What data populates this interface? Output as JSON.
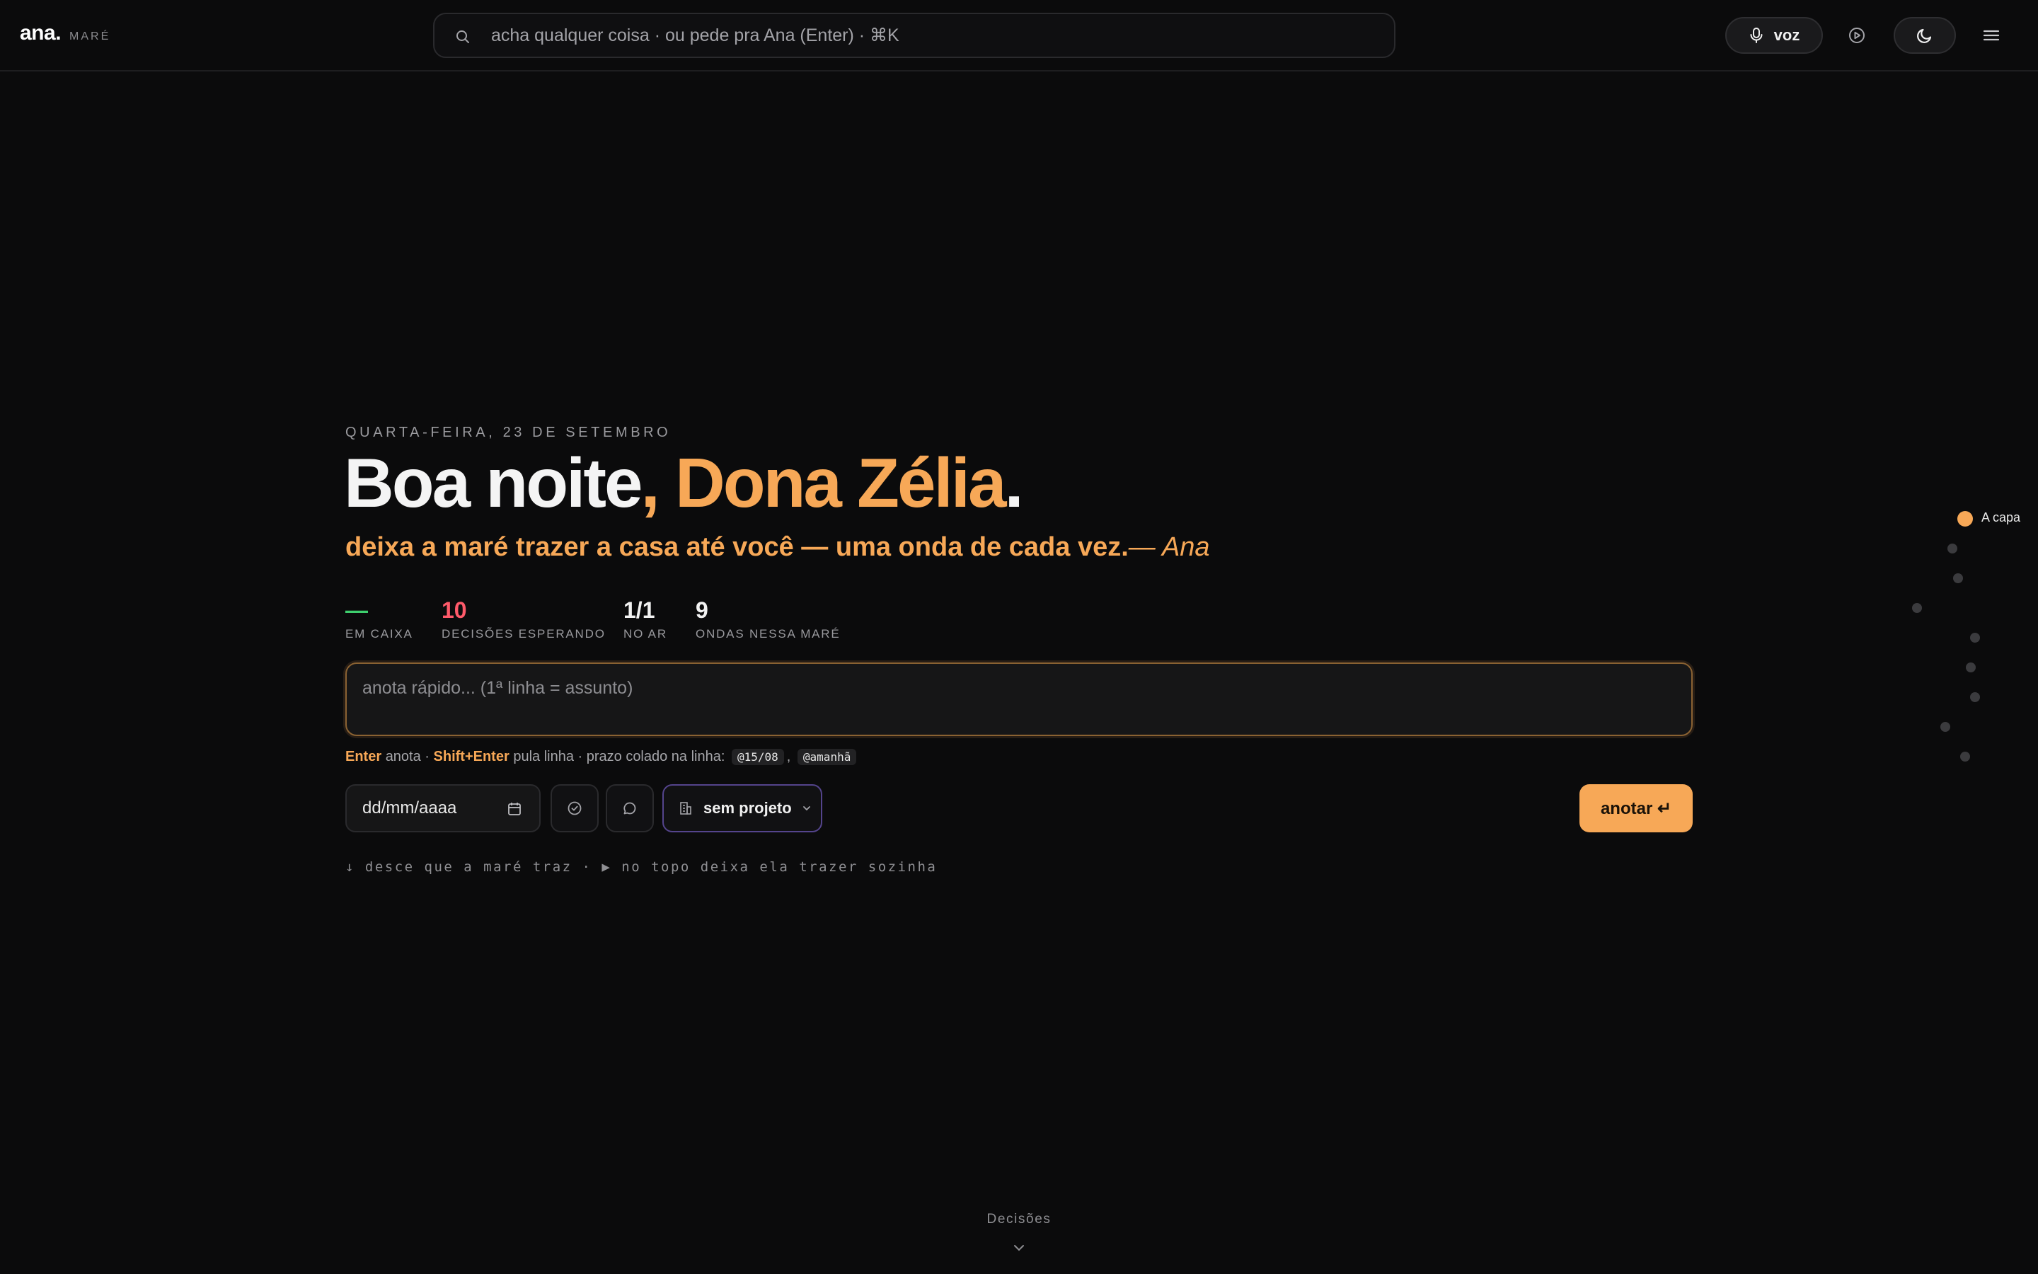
{
  "app": {
    "logo": "ana.",
    "subtitle": "MARÉ"
  },
  "search": {
    "placeholder": "acha qualquer coisa · ou pede pra Ana (Enter) · ⌘K",
    "icon": "search-icon"
  },
  "header_actions": {
    "voz_label": "voz",
    "play_icon": "play-circle-icon",
    "theme_icon": "moon-icon",
    "menu_icon": "menu-icon"
  },
  "hero": {
    "date": "QUARTA-FEIRA, 23 DE SETEMBRO",
    "greeting": "Boa noite",
    "comma": ",",
    "name": "Dona Zélia",
    "period": ".",
    "tagline": "deixa a maré trazer a casa até você — uma onda de cada vez.",
    "signature": "— Ana"
  },
  "stats": [
    {
      "value": "—",
      "label": "EM CAIXA",
      "color": "#3ecf6e"
    },
    {
      "value": "10",
      "label": "DECISÕES ESPERANDO",
      "color": "#ff5a6a"
    },
    {
      "value": "1/1",
      "label": "NO AR",
      "color": "#f4f4f4"
    },
    {
      "value": "9",
      "label": "ONDAS NESSA MARÉ",
      "color": "#f4f4f4"
    }
  ],
  "quicknote": {
    "placeholder": "anota rápido... (1ª linha = assunto)",
    "hint_enter": "Enter",
    "hint_enter_text": "anota ·",
    "hint_shift": "Shift+Enter",
    "hint_shift_text": "pula linha · prazo colado na linha:",
    "hint_code1": "@15/08",
    "hint_sep": ",",
    "hint_code2": "@amanhã",
    "date_placeholder": "dd/mm/aaaa",
    "project_label": "sem projeto",
    "submit_label": "anotar ↵"
  },
  "scroll_hint": "↓ desce que a maré traz · ▶ no topo deixa ela trazer sozinha",
  "rail": {
    "active_label": "A capa"
  },
  "next_section": {
    "label": "Decisões"
  },
  "colors": {
    "accent": "#f7a857",
    "background": "#0b0b0c",
    "project_border": "#54448c"
  }
}
